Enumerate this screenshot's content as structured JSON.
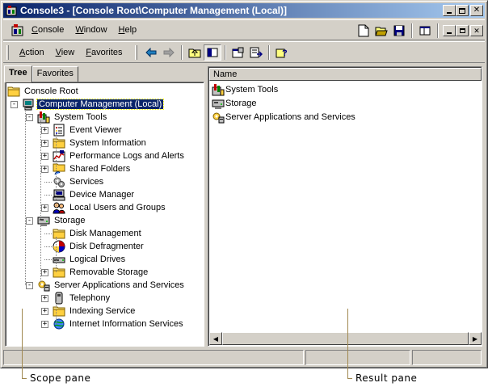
{
  "window": {
    "title": "Console3 - [Console Root\\Computer Management (Local)]",
    "caption_buttons": [
      "minimize",
      "maximize",
      "close"
    ]
  },
  "menubar": {
    "items": [
      {
        "label": "Console",
        "underline": "C"
      },
      {
        "label": "Window",
        "underline": "W"
      },
      {
        "label": "Help",
        "underline": "H"
      }
    ],
    "icons": [
      "new-icon",
      "open-icon",
      "save-icon",
      "new-window-icon",
      "mdi-minimize-icon",
      "mdi-restore-icon",
      "mdi-close-icon"
    ]
  },
  "toolbar": {
    "menus": [
      {
        "label": "Action",
        "underline": "A"
      },
      {
        "label": "View",
        "underline": "V"
      },
      {
        "label": "Favorites",
        "underline": "F"
      }
    ],
    "icons": [
      "back-arrow-icon",
      "forward-arrow-icon",
      "up-one-level-icon",
      "show-hide-tree-icon",
      "properties-icon",
      "export-list-icon",
      "help-icon"
    ]
  },
  "tabs": [
    "Tree",
    "Favorites"
  ],
  "tree": {
    "root": "Console Root",
    "selected": "Computer Management (Local)",
    "nodes": [
      {
        "label": "Console Root",
        "icon": "folder-icon",
        "expander": ""
      },
      {
        "label": "Computer Management (Local)",
        "icon": "computer-icon",
        "expander": "-"
      },
      {
        "label": "System Tools",
        "icon": "system-tools-icon",
        "expander": "-"
      },
      {
        "label": "Event Viewer",
        "icon": "event-viewer-icon",
        "expander": "+"
      },
      {
        "label": "System Information",
        "icon": "folder-icon",
        "expander": "+"
      },
      {
        "label": "Performance Logs and Alerts",
        "icon": "performance-icon",
        "expander": "+"
      },
      {
        "label": "Shared Folders",
        "icon": "shared-folder-icon",
        "expander": "+"
      },
      {
        "label": "Services",
        "icon": "services-icon",
        "expander": ""
      },
      {
        "label": "Device Manager",
        "icon": "device-manager-icon",
        "expander": ""
      },
      {
        "label": "Local Users and Groups",
        "icon": "users-icon",
        "expander": "+"
      },
      {
        "label": "Storage",
        "icon": "storage-icon",
        "expander": "-"
      },
      {
        "label": "Disk Management",
        "icon": "folder-icon",
        "expander": ""
      },
      {
        "label": "Disk Defragmenter",
        "icon": "defrag-icon",
        "expander": ""
      },
      {
        "label": "Logical Drives",
        "icon": "drive-icon",
        "expander": ""
      },
      {
        "label": "Removable Storage",
        "icon": "folder-icon",
        "expander": "+"
      },
      {
        "label": "Server Applications and Services",
        "icon": "server-apps-icon",
        "expander": "-"
      },
      {
        "label": "Telephony",
        "icon": "telephony-icon",
        "expander": "+"
      },
      {
        "label": "Indexing Service",
        "icon": "folder-icon",
        "expander": "+"
      },
      {
        "label": "Internet Information Services",
        "icon": "iis-icon",
        "expander": "+"
      }
    ]
  },
  "result": {
    "column_header": "Name",
    "items": [
      {
        "label": "System Tools",
        "icon": "system-tools-icon"
      },
      {
        "label": "Storage",
        "icon": "storage-icon"
      },
      {
        "label": "Server Applications and Services",
        "icon": "server-apps-icon"
      }
    ]
  },
  "callouts": {
    "scope": "Scope pane",
    "result": "Result pane"
  },
  "colors": {
    "title_gradient_start": "#0a246a",
    "title_gradient_end": "#a6caf0",
    "face": "#d4d0c8",
    "selection": "#0a246a",
    "callout": "#a08850"
  }
}
